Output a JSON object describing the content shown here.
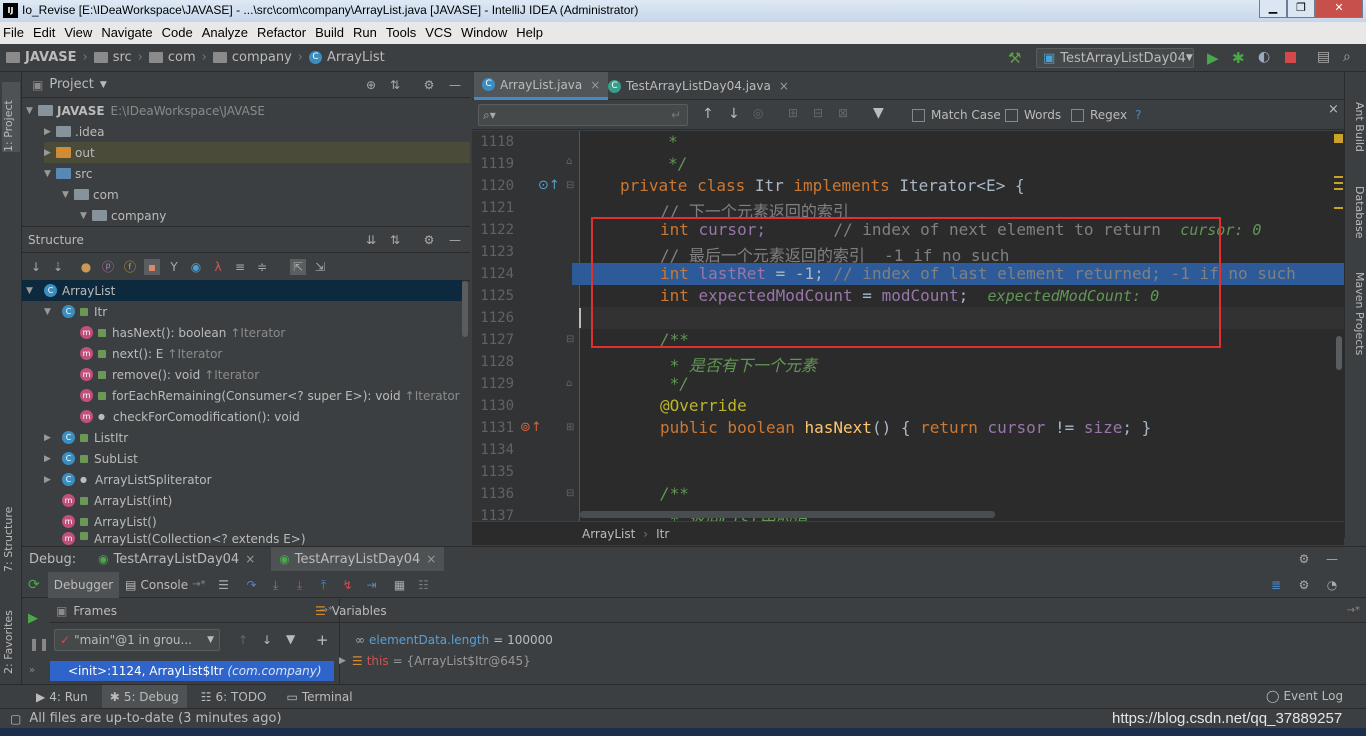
{
  "window": {
    "title": "Io_Revise [E:\\IDeaWorkspace\\JAVASE] - ...\\src\\com\\company\\ArrayList.java [JAVASE] - IntelliJ IDEA (Administrator)",
    "logo": "IJ"
  },
  "menu": [
    "File",
    "Edit",
    "View",
    "Navigate",
    "Code",
    "Analyze",
    "Refactor",
    "Build",
    "Run",
    "Tools",
    "VCS",
    "Window",
    "Help"
  ],
  "navbar": {
    "crumbs": [
      "JAVASE",
      "src",
      "com",
      "company",
      "ArrayList"
    ],
    "run_config": "TestArrayListDay04"
  },
  "left_stripe": {
    "project_tab": "1: Project",
    "structure_tab": "7: Structure",
    "favorites_tab": "2: Favorites"
  },
  "right_stripe": {
    "ant": "Ant Build",
    "database": "Database",
    "maven": "Maven Projects"
  },
  "project": {
    "header": "Project",
    "root_name": "JAVASE",
    "root_path": "E:\\IDeaWorkspace\\JAVASE",
    "items": [
      ".idea",
      "out",
      "src",
      "com",
      "company"
    ]
  },
  "structure": {
    "header": "Structure",
    "root": "ArrayList",
    "itr": "Itr",
    "itr_methods": [
      {
        "name": "hasNext(): boolean",
        "origin": "↑Iterator"
      },
      {
        "name": "next(): E",
        "origin": "↑Iterator"
      },
      {
        "name": "remove(): void",
        "origin": "↑Iterator"
      },
      {
        "name": "forEachRemaining(Consumer<? super E>): void",
        "origin": "↑Iterator"
      },
      {
        "name": "checkForComodification(): void",
        "origin": ""
      }
    ],
    "others": [
      "ListItr",
      "SubList",
      "ArrayListSpliterator",
      "ArrayList(int)",
      "ArrayList()",
      "ArrayList(Collection<? extends E>)"
    ]
  },
  "editor": {
    "tabs": [
      "ArrayList.java",
      "TestArrayListDay04.java"
    ],
    "search": {
      "match_case": "Match Case",
      "words": "Words",
      "regex": "Regex",
      "help": "?"
    },
    "line_numbers": [
      "1118",
      "1119",
      "1120",
      "1121",
      "1122",
      "1123",
      "1124",
      "1125",
      "1126",
      "1127",
      "1128",
      "1129",
      "1130",
      "1131",
      "1134",
      "1135",
      "1136",
      "1137"
    ],
    "breadcrumb": [
      "ArrayList",
      "Itr"
    ],
    "code": {
      "l1118": "     *",
      "l1119": "     */",
      "l1120_kw1": "private class ",
      "l1120_name": "Itr ",
      "l1120_kw2": "implements ",
      "l1120_rest": "Iterator<E> {",
      "l1121": "// 下一个元素返回的索引",
      "l1122_kw": "int ",
      "l1122_var": "cursor;",
      "l1122_cm": "       // index of next element to return  ",
      "l1122_hint": "cursor: 0",
      "l1123": "// 最后一个元素返回的索引  -1 if no such",
      "l1124_kw": "int ",
      "l1124_var": "lastRet",
      "l1124_rest": " = -1; ",
      "l1124_cm": "// index of last element returned; -1 if no such",
      "l1125_kw": "int ",
      "l1125_var": "expectedModCount",
      "l1125_eq": " = ",
      "l1125_f": "modCount",
      "l1125_semi": ";  ",
      "l1125_hint": "expectedModCount: 0",
      "l1127": "/**",
      "l1128": " * 是否有下一个元素",
      "l1129": " */",
      "l1130": "@Override",
      "l1131_kw": "public boolean ",
      "l1131_fn": "hasNext",
      "l1131_p": "() { ",
      "l1131_ret": "return ",
      "l1131_c": "cursor",
      "l1131_ne": " != ",
      "l1131_s": "size",
      "l1131_end": "; }",
      "l1136": "/**",
      "l1137": " * 返回List中的值"
    }
  },
  "debug": {
    "label": "Debug:",
    "sessions": [
      "TestArrayListDay04",
      "TestArrayListDay04"
    ],
    "tabs": {
      "debugger": "Debugger",
      "console": "Console"
    },
    "frames_header": "Frames",
    "variables_header": "Variables",
    "thread": "\"main\"@1 in grou...",
    "frame": "<init>:1124, ArrayList$Itr",
    "frame_pkg": "(com.company)",
    "variables": [
      {
        "name": "elementData.length",
        "value": "= 100000"
      },
      {
        "name": "this",
        "value": "= {ArrayList$Itr@645}"
      }
    ]
  },
  "bottom_tabs": [
    "4: Run",
    "5: Debug",
    "6: TODO",
    "Terminal"
  ],
  "event_log": "Event Log",
  "status": "All files are up-to-date (3 minutes ago)",
  "watermark": "https://blog.csdn.net/qq_37889257"
}
